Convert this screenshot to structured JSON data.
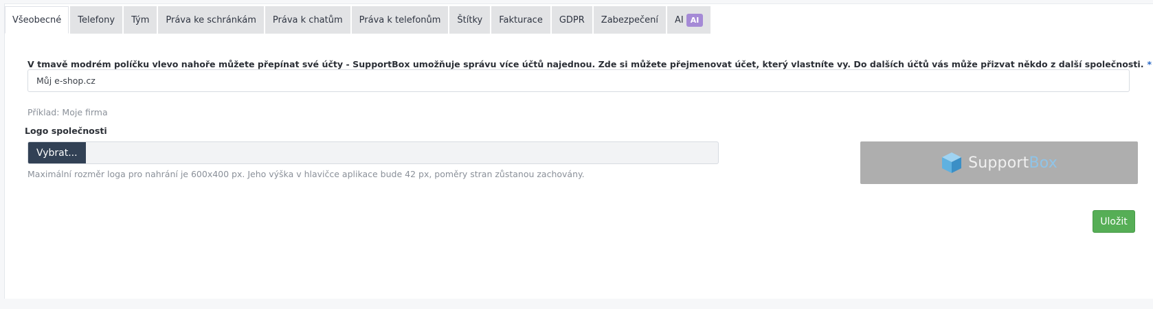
{
  "tabs": [
    {
      "label": "Všeobecné",
      "active": true
    },
    {
      "label": "Telefony"
    },
    {
      "label": "Tým"
    },
    {
      "label": "Práva ke schránkám"
    },
    {
      "label": "Práva k chatům"
    },
    {
      "label": "Práva k telefonům"
    },
    {
      "label": "Štítky"
    },
    {
      "label": "Fakturace"
    },
    {
      "label": "GDPR"
    },
    {
      "label": "Zabezpečení"
    },
    {
      "label": "AI",
      "badge": "AI"
    }
  ],
  "form": {
    "account_label": "V tmavě modrém políčku vlevo nahoře můžete přepínat své účty - SupportBox umožňuje správu více účtů najednou. Zde si můžete přejmenovat účet, který vlastníte vy. Do dalších účtů vás může přizvat někdo z další společnosti.",
    "required_mark": "*",
    "account_value": "Můj e-shop.cz",
    "account_example": "Příklad: Moje firma",
    "logo_label": "Logo společnosti",
    "choose_button": "Vybrat...",
    "logo_hint": "Maximální rozměr loga pro nahrání je 600x400 px. Jeho výška v hlavičce aplikace bude 42 px, poměry stran zůstanou zachovány.",
    "logo_preview": {
      "brand_part1": "Support",
      "brand_part2": "Box"
    },
    "save_button": "Uložit"
  },
  "colors": {
    "save_green": "#56ae56",
    "choose_dark": "#324155",
    "ai_badge": "#a58ad6",
    "required": "#2b68c5",
    "logo_bg": "#aeaeae"
  }
}
